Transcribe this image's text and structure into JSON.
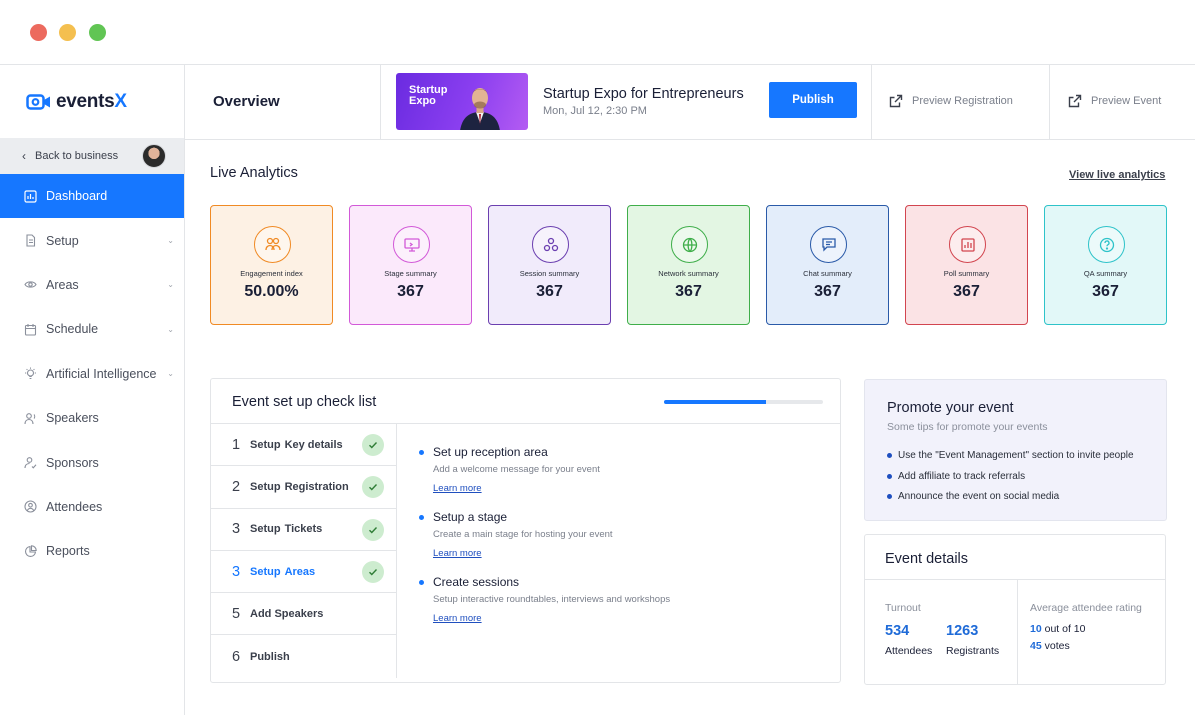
{
  "window": {
    "controls": [
      "close",
      "minimize",
      "maximize"
    ]
  },
  "brand": {
    "name_main": "events",
    "name_accent": "X",
    "accent_color": "#1677ff"
  },
  "sidebar": {
    "back_label": "Back to business",
    "items": [
      {
        "label": "Dashboard",
        "icon": "dashboard-icon",
        "active": true,
        "has_caret": false
      },
      {
        "label": "Setup",
        "icon": "document-icon",
        "has_caret": true
      },
      {
        "label": "Areas",
        "icon": "eye-icon",
        "has_caret": true
      },
      {
        "label": "Schedule",
        "icon": "calendar-icon",
        "has_caret": true
      },
      {
        "label": "Artificial Intelligence",
        "icon": "lightbulb-icon",
        "has_caret": true
      },
      {
        "label": "Speakers",
        "icon": "speaker-user-icon",
        "has_caret": false
      },
      {
        "label": "Sponsors",
        "icon": "sponsor-user-icon",
        "has_caret": false
      },
      {
        "label": "Attendees",
        "icon": "attendee-circle-icon",
        "has_caret": false
      },
      {
        "label": "Reports",
        "icon": "pie-chart-icon",
        "has_caret": false
      }
    ]
  },
  "header": {
    "page_title": "Overview",
    "thumbnail_text": "Startup Expo",
    "event_title": "Startup Expo for Entrepreneurs",
    "event_date": "Mon, Jul 12, 2:30 PM",
    "publish_label": "Publish",
    "preview_registration": "Preview Registration",
    "preview_event": "Preview Event"
  },
  "analytics": {
    "title": "Live Analytics",
    "link": "View live analytics",
    "cards": [
      {
        "label": "Engagement index",
        "value": "50.00%",
        "icon": "people-icon",
        "color": "#f08a24",
        "bg": "#fdf1e4"
      },
      {
        "label": "Stage summary",
        "value": "367",
        "icon": "stage-screen-icon",
        "color": "#d259d8",
        "bg": "#fbe9fb"
      },
      {
        "label": "Session summary",
        "value": "367",
        "icon": "session-cluster-icon",
        "color": "#6b3fb0",
        "bg": "#f1ebfb"
      },
      {
        "label": "Network summary",
        "value": "367",
        "icon": "globe-icon",
        "color": "#3fae4a",
        "bg": "#e3f6e3"
      },
      {
        "label": "Chat summary",
        "value": "367",
        "icon": "chat-icon",
        "color": "#2a5aa8",
        "bg": "#e3edfa"
      },
      {
        "label": "Poll summary",
        "value": "367",
        "icon": "poll-icon",
        "color": "#d2454f",
        "bg": "#fbe3e5"
      },
      {
        "label": "QA summary",
        "value": "367",
        "icon": "question-icon",
        "color": "#2ec3c9",
        "bg": "#e2f8f8"
      }
    ]
  },
  "checklist": {
    "title": "Event set up check list",
    "progress": 0.64,
    "steps": [
      {
        "num": "1",
        "prefix": "Setup",
        "label": "Key details",
        "done": true,
        "current": false
      },
      {
        "num": "2",
        "prefix": "Setup",
        "label": "Registration",
        "done": true,
        "current": false
      },
      {
        "num": "3",
        "prefix": "Setup",
        "label": "Tickets",
        "done": true,
        "current": false
      },
      {
        "num": "3",
        "prefix": "Setup",
        "label": "Areas",
        "done": true,
        "current": true
      },
      {
        "num": "5",
        "prefix": "",
        "label": "Add Speakers",
        "done": false,
        "current": false
      },
      {
        "num": "6",
        "prefix": "",
        "label": "Publish",
        "done": false,
        "current": false
      }
    ],
    "tasks": [
      {
        "title": "Set up reception area",
        "desc": "Add a welcome message for your event",
        "link": "Learn more"
      },
      {
        "title": "Setup a stage",
        "desc": "Create a main stage for hosting your event",
        "link": "Learn more"
      },
      {
        "title": "Create sessions",
        "desc": "Setup interactive roundtables, interviews and workshops",
        "link": "Learn more"
      }
    ]
  },
  "promote": {
    "title": "Promote your event",
    "subtitle": "Some tips for promote your events",
    "tips": [
      "Use the \"Event Management\" section to invite people",
      "Add affiliate to track referrals",
      "Announce the event on social media"
    ]
  },
  "event_details": {
    "title": "Event details",
    "turnout_label": "Turnout",
    "attendees_value": "534",
    "attendees_label": "Attendees",
    "registrants_value": "1263",
    "registrants_label": "Registrants",
    "rating_label": "Average attendee rating",
    "rating_value": "10",
    "rating_suffix": " out of 10",
    "votes_value": "45",
    "votes_suffix": " votes"
  }
}
